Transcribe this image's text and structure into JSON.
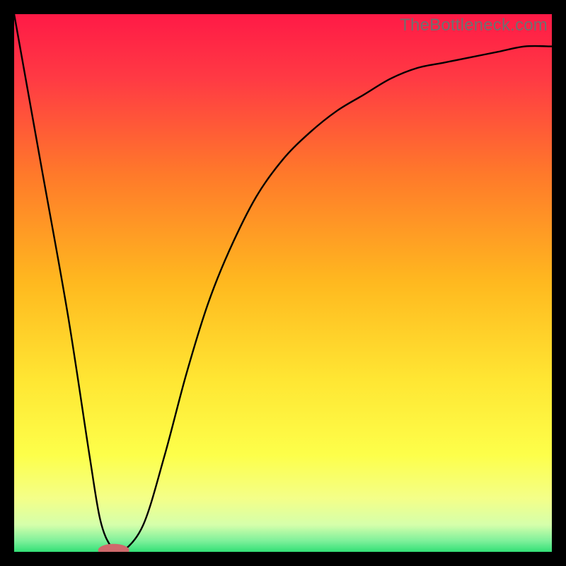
{
  "watermark": "TheBottleneck.com",
  "chart_data": {
    "type": "line",
    "title": "",
    "xlabel": "",
    "ylabel": "",
    "xlim": [
      0,
      100
    ],
    "ylim": [
      0,
      100
    ],
    "grid": false,
    "legend": false,
    "series": [
      {
        "name": "bottleneck-curve",
        "x": [
          0,
          5,
          10,
          14,
          16,
          18,
          20,
          24,
          28,
          32,
          36,
          40,
          45,
          50,
          55,
          60,
          65,
          70,
          75,
          80,
          85,
          90,
          95,
          100
        ],
        "y": [
          100,
          72,
          44,
          18,
          6,
          1,
          0,
          5,
          18,
          33,
          46,
          56,
          66,
          73,
          78,
          82,
          85,
          88,
          90,
          91,
          92,
          93,
          94,
          94
        ]
      }
    ],
    "marker": {
      "name": "optimal-point",
      "x": 18.5,
      "y": 0.3,
      "color": "#cf6a6c"
    },
    "background_gradient": {
      "top": "#ff1a46",
      "mid_upper": "#ff9a1f",
      "mid": "#ffe633",
      "mid_lower": "#ffff80",
      "bottom": "#33e076"
    }
  }
}
